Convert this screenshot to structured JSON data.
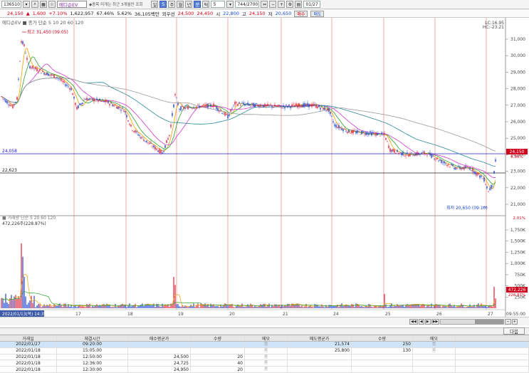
{
  "toolbar": {
    "code": "136510",
    "name": "에디슨EV",
    "notice": "◆종목 미개는 최근 3개월만 조회",
    "period_value": "5",
    "count_value": "744",
    "count_total": "2700",
    "date_value": "01/27",
    "btn_labels": [
      "일",
      "5",
      "주",
      "월",
      "년",
      "분",
      "틱"
    ]
  },
  "quote": {
    "price": "24,150",
    "change_sign": "▲",
    "change": "1,600",
    "change_pct": "+7.10%",
    "volume": "1,622,957",
    "vol_pct": "67.46%",
    "rate": "5.62%",
    "amount": "36,105백만",
    "prev_label": "외우선",
    "prev_value": "24,500",
    "ask": "24,450",
    "open_label": "시",
    "open": "22,800",
    "high_label": "고",
    "high": "24,150",
    "low_label": "저",
    "low": "20,650",
    "buy_label": "매수",
    "sell_label": "매도"
  },
  "chart": {
    "legend_price": "에디슨EV ■ 종가 단순 5  10  20  60  120",
    "lc": "LC:16.95",
    "hc": "HC:-23.21",
    "high_annotation": "최고 31,450 (09:05)",
    "low_annotation": "최저 20,650 (09:10)",
    "left_level_1": "24,058",
    "left_level_2": "22,623",
    "price_ticks": [
      "31,000",
      "30,000",
      "29,000",
      "28,000",
      "27,000",
      "26,000",
      "25,000",
      "24,000",
      "23,000",
      "22,000",
      "21,000"
    ],
    "current_price_tag": "24,150",
    "current_price_pct": "6.86%",
    "vol_legend": "■ 거래량 단순 5  20  60  120",
    "vol_current": "472,226주(228.87%)",
    "vol_ticks": [
      "1,750K",
      "1,500K",
      "1,250K",
      "1,000K",
      "750K",
      "500K",
      "250K"
    ],
    "vol_right_top": "2.01%",
    "vol_current_tag": "472,226",
    "vol_current_pct": "228.87%",
    "x_start": "2022/01/13(목) 14:35:00",
    "x_ticks": [
      "17",
      "18",
      "19",
      "20",
      "21",
      "24",
      "25",
      "26",
      "27"
    ],
    "time_right": "09:55:00",
    "colors": {
      "candle_up": "#e0203a",
      "candle_dn": "#1d45d0",
      "ma5": "#f0a000",
      "ma10": "#2aa030",
      "ma20": "#d03ad0",
      "ma60": "#2a8a9a",
      "ma120": "#9a9a9a",
      "hline_blue": "#2020d0",
      "hline_black": "#202020",
      "day_divider": "#e05050"
    }
  },
  "navbar": {
    "next_label": "다음"
  },
  "table": {
    "headers": [
      "거래일",
      "체결시간",
      "매수평균가",
      "수량",
      "메모",
      "매도평균가",
      "수량",
      "메모"
    ],
    "rows": [
      {
        "date": "2022/01/27",
        "time": "09:20:00",
        "buy_avg": "",
        "buy_qty": "",
        "sell_avg": "21,574",
        "sell_qty": "250"
      },
      {
        "date": "2022/01/18",
        "time": "15:05:00",
        "buy_avg": "",
        "buy_qty": "",
        "sell_avg": "25,800",
        "sell_qty": "130"
      },
      {
        "date": "2022/01/18",
        "time": "12:50:00",
        "buy_avg": "24,500",
        "buy_qty": "20",
        "sell_avg": "",
        "sell_qty": ""
      },
      {
        "date": "2022/01/18",
        "time": "12:36:00",
        "buy_avg": "24,725",
        "buy_qty": "40",
        "sell_avg": "",
        "sell_qty": ""
      },
      {
        "date": "2022/01/18",
        "time": "12:30:00",
        "buy_avg": "24,950",
        "buy_qty": "20",
        "sell_avg": "",
        "sell_qty": ""
      }
    ]
  }
}
